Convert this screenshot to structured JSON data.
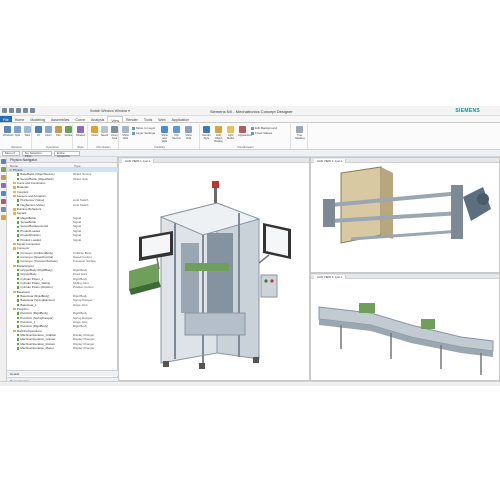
{
  "titlebar": {
    "app_title": "Siemens NX - Mechatronics Concept Designer",
    "document": "Switch Window  Window ▾",
    "brand": "SIEMENS"
  },
  "menu_tabs": [
    "File",
    "Home",
    "Modeling",
    "Assemblies",
    "Curve",
    "Analysis",
    "View",
    "Render",
    "Tools",
    "Web",
    "Application"
  ],
  "active_tab": "View",
  "ribbon": {
    "groups": [
      {
        "label": "Window",
        "buttons": [
          "Windows",
          "Split",
          "Tabs"
        ]
      },
      {
        "label": "Operation",
        "buttons": [
          "Fit",
          "Zoom",
          "Pan",
          "Rotate"
        ]
      },
      {
        "label": "Style",
        "buttons": [
          "Shaded"
        ]
      },
      {
        "label": "Orientation",
        "buttons": [
          "Views",
          "Saved",
          "Zoom Area"
        ]
      },
      {
        "label": "Visibility",
        "buttons": [
          "Show Hide",
          "Move to Layer",
          "Layer Settings",
          "Show and Hide",
          "Clip Section",
          "Show Hide"
        ]
      },
      {
        "label": "Visualization",
        "buttons": [
          "Render Style",
          "Edit Object Display",
          "Light Studio",
          "Appearance",
          "Edit Background",
          "Fixed Values"
        ]
      },
      {
        "label": "",
        "buttons": [
          "True Shading"
        ]
      }
    ],
    "small_items": [
      "Move to Layer",
      "Layer Settings",
      "Edit Background",
      "Fixed Values"
    ]
  },
  "selection_bar": {
    "menu": "Menu ▾",
    "filter": "No Selection Filter",
    "scope": "Entire Assembly"
  },
  "navigator": {
    "title": "Physics Navigator",
    "columns": [
      "Name",
      "Type"
    ],
    "rows": [
      {
        "name": "Physics",
        "type": "",
        "indent": 0,
        "kind": "folder",
        "selected": true
      },
      {
        "name": "BaseBottle (ObjectSource)",
        "type": "Object Source",
        "indent": 2,
        "kind": "check"
      },
      {
        "name": "SensorBottle (ObjectSink)",
        "type": "Object Sink",
        "indent": 2,
        "kind": "check"
      },
      {
        "name": "Joints and Constraints",
        "type": "",
        "indent": 1,
        "kind": "folder"
      },
      {
        "name": "Materials",
        "type": "",
        "indent": 1,
        "kind": "folder"
      },
      {
        "name": "Couplers",
        "type": "",
        "indent": 1,
        "kind": "folder"
      },
      {
        "name": "Sensors and Actuators",
        "type": "",
        "indent": 1,
        "kind": "folder"
      },
      {
        "name": "PosSensor (Valve)",
        "type": "Limit Switch",
        "indent": 2,
        "kind": "check"
      },
      {
        "name": "NegSensor (Valve)",
        "type": "Limit Switch",
        "indent": 2,
        "kind": "check"
      },
      {
        "name": "Runtime Behaviors",
        "type": "",
        "indent": 1,
        "kind": "folder"
      },
      {
        "name": "Signals",
        "type": "",
        "indent": 1,
        "kind": "folder"
      },
      {
        "name": "MagAtBottle",
        "type": "Signal",
        "indent": 2,
        "kind": "check"
      },
      {
        "name": "SenseBottle",
        "type": "Signal",
        "indent": 2,
        "kind": "check"
      },
      {
        "name": "SensorBottleLowered",
        "type": "Signal",
        "indent": 2,
        "kind": "check"
      },
      {
        "name": "ProductLoaded",
        "type": "Signal",
        "indent": 2,
        "kind": "check"
      },
      {
        "name": "ProductPosition",
        "type": "Signal",
        "indent": 2,
        "kind": "check"
      },
      {
        "name": "Product Loaded",
        "type": "Signal",
        "indent": 2,
        "kind": "check"
      },
      {
        "name": "Signal Connection",
        "type": "",
        "indent": 1,
        "kind": "folder"
      },
      {
        "name": "Conveyor",
        "type": "",
        "indent": 1,
        "kind": "folder"
      },
      {
        "name": "Conveyor (CollisionBody)",
        "type": "Collision Body",
        "indent": 2,
        "kind": "check"
      },
      {
        "name": "Conveyor (SpeedControl)",
        "type": "Speed Control",
        "indent": 2,
        "kind": "check"
      },
      {
        "name": "Conveyor (TransportSurface)",
        "type": "Transport Surface",
        "indent": 2,
        "kind": "check"
      },
      {
        "name": "BottleGripper",
        "type": "",
        "indent": 1,
        "kind": "folder"
      },
      {
        "name": "GripperBody (RigidBody)",
        "type": "Rigid Body",
        "indent": 2,
        "kind": "check"
      },
      {
        "name": "GripperBody",
        "type": "Fixed Joint",
        "indent": 2,
        "kind": "check"
      },
      {
        "name": "Cylinder Piston_1",
        "type": "Rigid Body",
        "indent": 2,
        "kind": "check"
      },
      {
        "name": "Cylinder Piston_Sliding",
        "type": "Sliding Joint",
        "indent": 2,
        "kind": "check"
      },
      {
        "name": "Cylinder Piston (Position)",
        "type": "Position Control",
        "indent": 2,
        "kind": "check"
      },
      {
        "name": "BaseGear",
        "type": "",
        "indent": 1,
        "kind": "folder"
      },
      {
        "name": "BaseGear (RigidBody)",
        "type": "Rigid Body",
        "indent": 2,
        "kind": "check"
      },
      {
        "name": "BaseGear (SpringDamper)",
        "type": "Spring Damper",
        "indent": 2,
        "kind": "check"
      },
      {
        "name": "BaseGear_1",
        "type": "Hinge Joint",
        "indent": 2,
        "kind": "check"
      },
      {
        "name": "PivotArm",
        "type": "",
        "indent": 1,
        "kind": "folder"
      },
      {
        "name": "PivotArm (RigidBody)",
        "type": "Rigid Body",
        "indent": 2,
        "kind": "check"
      },
      {
        "name": "PivotArm (SpringDamper)",
        "type": "Spring Damper",
        "indent": 2,
        "kind": "check"
      },
      {
        "name": "PivotArm_1",
        "type": "Hinge Joint",
        "indent": 2,
        "kind": "check"
      },
      {
        "name": "PivotArm (RigidBody)",
        "type": "Rigid Body",
        "indent": 2,
        "kind": "check"
      },
      {
        "name": "MachineOperations",
        "type": "",
        "indent": 1,
        "kind": "folder"
      },
      {
        "name": "MachineOperation_Grabber",
        "type": "Display Changer",
        "indent": 2,
        "kind": "check"
      },
      {
        "name": "MachineOperation_Gripper",
        "type": "Display Changer",
        "indent": 2,
        "kind": "check"
      },
      {
        "name": "MachineOperation_Rotator",
        "type": "Display Changer",
        "indent": 2,
        "kind": "check"
      },
      {
        "name": "MachineOperation_Placer",
        "type": "Display Changer",
        "indent": 2,
        "kind": "check"
      }
    ],
    "footer_panels": [
      "Details",
      "Dependencies"
    ]
  },
  "viewports": [
    {
      "tab": "3-D0 VIEW 1, Lyst 1"
    },
    {
      "tab": "3-D0 VIEW 2, Lyst 1"
    },
    {
      "tab": "3-D0 VIEW 3, Lyst 1"
    }
  ],
  "colors": {
    "file_tab": "#1f6fb2",
    "brand": "#009999",
    "selection": "#cfe3f7",
    "machine_frame": "#b8c2cc",
    "conveyor_green": "#6f9f5a",
    "motor": "#5c6f80",
    "panel_tan": "#d9c9a3"
  }
}
